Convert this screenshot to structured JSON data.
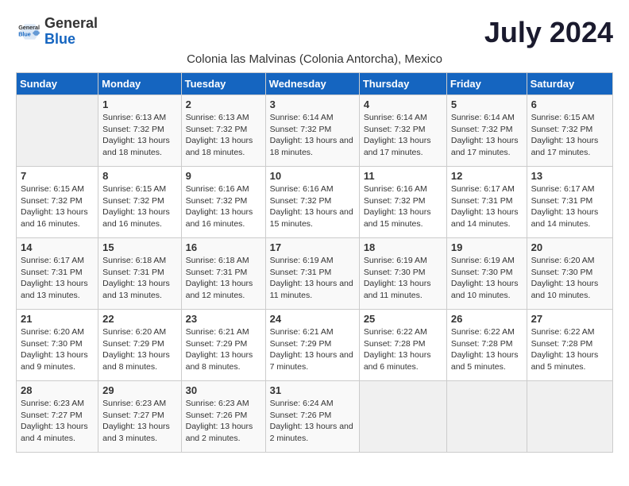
{
  "header": {
    "logo_general": "General",
    "logo_blue": "Blue",
    "month_year": "July 2024",
    "subtitle": "Colonia las Malvinas (Colonia Antorcha), Mexico"
  },
  "weekdays": [
    "Sunday",
    "Monday",
    "Tuesday",
    "Wednesday",
    "Thursday",
    "Friday",
    "Saturday"
  ],
  "weeks": [
    [
      {
        "day": "",
        "sunrise": "",
        "sunset": "",
        "daylight": "",
        "empty": true
      },
      {
        "day": "1",
        "sunrise": "6:13 AM",
        "sunset": "7:32 PM",
        "daylight": "13 hours and 18 minutes."
      },
      {
        "day": "2",
        "sunrise": "6:13 AM",
        "sunset": "7:32 PM",
        "daylight": "13 hours and 18 minutes."
      },
      {
        "day": "3",
        "sunrise": "6:14 AM",
        "sunset": "7:32 PM",
        "daylight": "13 hours and 18 minutes."
      },
      {
        "day": "4",
        "sunrise": "6:14 AM",
        "sunset": "7:32 PM",
        "daylight": "13 hours and 17 minutes."
      },
      {
        "day": "5",
        "sunrise": "6:14 AM",
        "sunset": "7:32 PM",
        "daylight": "13 hours and 17 minutes."
      },
      {
        "day": "6",
        "sunrise": "6:15 AM",
        "sunset": "7:32 PM",
        "daylight": "13 hours and 17 minutes."
      }
    ],
    [
      {
        "day": "7",
        "sunrise": "6:15 AM",
        "sunset": "7:32 PM",
        "daylight": "13 hours and 16 minutes."
      },
      {
        "day": "8",
        "sunrise": "6:15 AM",
        "sunset": "7:32 PM",
        "daylight": "13 hours and 16 minutes."
      },
      {
        "day": "9",
        "sunrise": "6:16 AM",
        "sunset": "7:32 PM",
        "daylight": "13 hours and 16 minutes."
      },
      {
        "day": "10",
        "sunrise": "6:16 AM",
        "sunset": "7:32 PM",
        "daylight": "13 hours and 15 minutes."
      },
      {
        "day": "11",
        "sunrise": "6:16 AM",
        "sunset": "7:32 PM",
        "daylight": "13 hours and 15 minutes."
      },
      {
        "day": "12",
        "sunrise": "6:17 AM",
        "sunset": "7:31 PM",
        "daylight": "13 hours and 14 minutes."
      },
      {
        "day": "13",
        "sunrise": "6:17 AM",
        "sunset": "7:31 PM",
        "daylight": "13 hours and 14 minutes."
      }
    ],
    [
      {
        "day": "14",
        "sunrise": "6:17 AM",
        "sunset": "7:31 PM",
        "daylight": "13 hours and 13 minutes."
      },
      {
        "day": "15",
        "sunrise": "6:18 AM",
        "sunset": "7:31 PM",
        "daylight": "13 hours and 13 minutes."
      },
      {
        "day": "16",
        "sunrise": "6:18 AM",
        "sunset": "7:31 PM",
        "daylight": "13 hours and 12 minutes."
      },
      {
        "day": "17",
        "sunrise": "6:19 AM",
        "sunset": "7:31 PM",
        "daylight": "13 hours and 11 minutes."
      },
      {
        "day": "18",
        "sunrise": "6:19 AM",
        "sunset": "7:30 PM",
        "daylight": "13 hours and 11 minutes."
      },
      {
        "day": "19",
        "sunrise": "6:19 AM",
        "sunset": "7:30 PM",
        "daylight": "13 hours and 10 minutes."
      },
      {
        "day": "20",
        "sunrise": "6:20 AM",
        "sunset": "7:30 PM",
        "daylight": "13 hours and 10 minutes."
      }
    ],
    [
      {
        "day": "21",
        "sunrise": "6:20 AM",
        "sunset": "7:30 PM",
        "daylight": "13 hours and 9 minutes."
      },
      {
        "day": "22",
        "sunrise": "6:20 AM",
        "sunset": "7:29 PM",
        "daylight": "13 hours and 8 minutes."
      },
      {
        "day": "23",
        "sunrise": "6:21 AM",
        "sunset": "7:29 PM",
        "daylight": "13 hours and 8 minutes."
      },
      {
        "day": "24",
        "sunrise": "6:21 AM",
        "sunset": "7:29 PM",
        "daylight": "13 hours and 7 minutes."
      },
      {
        "day": "25",
        "sunrise": "6:22 AM",
        "sunset": "7:28 PM",
        "daylight": "13 hours and 6 minutes."
      },
      {
        "day": "26",
        "sunrise": "6:22 AM",
        "sunset": "7:28 PM",
        "daylight": "13 hours and 5 minutes."
      },
      {
        "day": "27",
        "sunrise": "6:22 AM",
        "sunset": "7:28 PM",
        "daylight": "13 hours and 5 minutes."
      }
    ],
    [
      {
        "day": "28",
        "sunrise": "6:23 AM",
        "sunset": "7:27 PM",
        "daylight": "13 hours and 4 minutes."
      },
      {
        "day": "29",
        "sunrise": "6:23 AM",
        "sunset": "7:27 PM",
        "daylight": "13 hours and 3 minutes."
      },
      {
        "day": "30",
        "sunrise": "6:23 AM",
        "sunset": "7:26 PM",
        "daylight": "13 hours and 2 minutes."
      },
      {
        "day": "31",
        "sunrise": "6:24 AM",
        "sunset": "7:26 PM",
        "daylight": "13 hours and 2 minutes."
      },
      {
        "day": "",
        "sunrise": "",
        "sunset": "",
        "daylight": "",
        "empty": true
      },
      {
        "day": "",
        "sunrise": "",
        "sunset": "",
        "daylight": "",
        "empty": true
      },
      {
        "day": "",
        "sunrise": "",
        "sunset": "",
        "daylight": "",
        "empty": true
      }
    ]
  ],
  "labels": {
    "sunrise_prefix": "Sunrise: ",
    "sunset_prefix": "Sunset: ",
    "daylight_prefix": "Daylight: "
  }
}
